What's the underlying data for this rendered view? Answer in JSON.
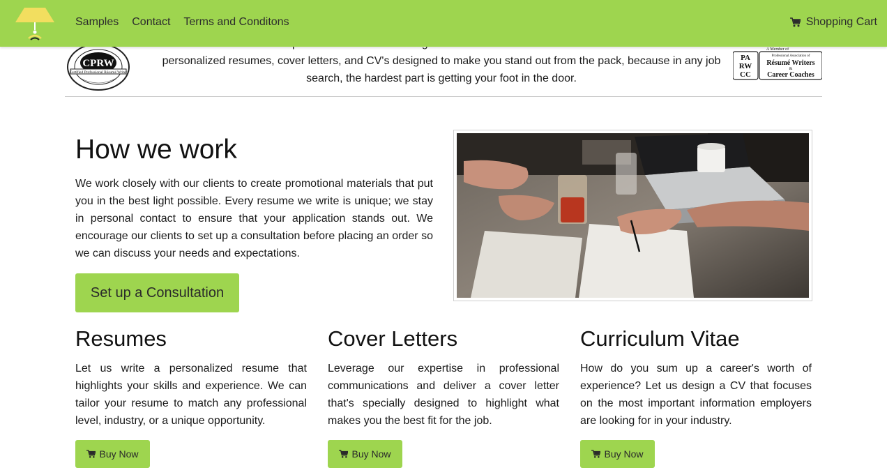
{
  "nav": {
    "links": [
      "Samples",
      "Contact",
      "Terms and Conditons"
    ],
    "cart_label": "Shopping Cart"
  },
  "intro": {
    "text": "Resumes that Resonate is a professional resume writing service dedicated to the absolute best client service. We offer personalized resumes, cover letters, and CV's designed to make you stand out from the pack, because in any job search, the hardest part is getting your foot in the door.",
    "cprw_logo_text": "CPRW",
    "parwcc_logo": {
      "letters": "PA RW CC",
      "member": "A Member of",
      "org_small": "Professional Association of",
      "org_line1": "Résumé Writers",
      "org_amp": "&",
      "org_line2": "Career Coaches"
    }
  },
  "how": {
    "title": "How we work",
    "text": "We work closely with our clients to create promotional materials that put you in the best light possible. Every resume we write is unique; we stay in personal contact to ensure that your application stands out. We encourage our clients to set up a consultation before placing an order so we can discuss your needs and expectations.",
    "button": "Set up a Consultation"
  },
  "services": [
    {
      "title": "Resumes",
      "text": "Let us write a personalized resume that highlights your skills and experience. We can tailor your resume to match any professional level, industry, or a unique opportunity.",
      "button": "Buy Now"
    },
    {
      "title": "Cover Letters",
      "text": "Leverage our expertise in professional communications and deliver a cover letter that's specially designed to highlight what makes you the best fit for the job.",
      "button": "Buy Now"
    },
    {
      "title": "Curriculum Vitae",
      "text": "How do you sum up a career's worth of experience? Let us design a CV that focuses on the most important information employers are looking for in your industry.",
      "button": "Buy Now"
    }
  ],
  "colors": {
    "accent": "#9ed54f",
    "lamp": "#f2de5f"
  },
  "icons": {
    "logo": "lamp-logo-icon",
    "cart": "shopping-cart-icon"
  }
}
